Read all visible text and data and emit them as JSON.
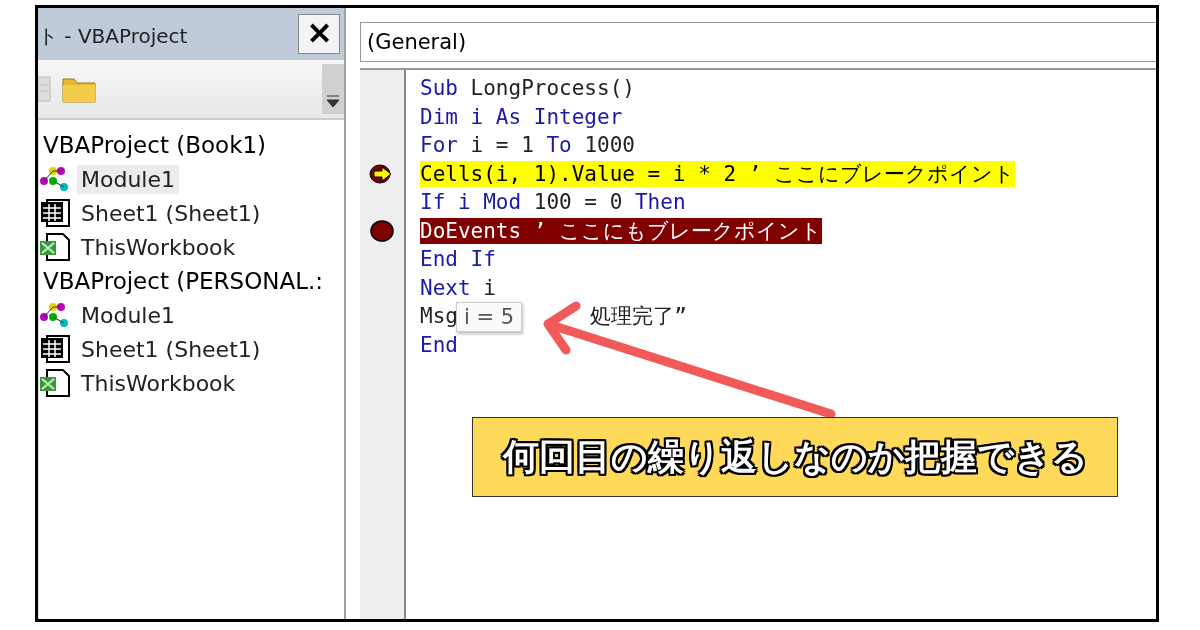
{
  "project_panel": {
    "title": "ト - VBAProject",
    "close": "✕",
    "tree": [
      {
        "label": "VBAProject (Book1)",
        "children": [
          {
            "label": "Module1",
            "kind": "module",
            "selected": true
          },
          {
            "label": "Sheet1 (Sheet1)",
            "kind": "sheet",
            "selected": false
          },
          {
            "label": "ThisWorkbook",
            "kind": "workbook",
            "selected": false
          }
        ]
      },
      {
        "label": "VBAProject (PERSONAL.:",
        "children": [
          {
            "label": "Module1",
            "kind": "module",
            "selected": false
          },
          {
            "label": "Sheet1 (Sheet1)",
            "kind": "sheet",
            "selected": false
          },
          {
            "label": "ThisWorkbook",
            "kind": "workbook",
            "selected": false
          }
        ]
      }
    ]
  },
  "code_window": {
    "object_box": "(General)",
    "lines": [
      {
        "current": false,
        "breakpoint": false,
        "parts": [
          {
            "text": "Sub",
            "keyword": true
          },
          {
            "text": " LongProcess()",
            "keyword": false
          }
        ]
      },
      {
        "current": false,
        "breakpoint": false,
        "parts": [
          {
            "text": "Dim i As Integer",
            "keyword": true
          }
        ]
      },
      {
        "current": false,
        "breakpoint": false,
        "parts": [
          {
            "text": "For",
            "keyword": true
          },
          {
            "text": " i = 1 ",
            "keyword": false
          },
          {
            "text": "To",
            "keyword": true
          },
          {
            "text": " 1000",
            "keyword": false
          }
        ]
      },
      {
        "current": true,
        "breakpoint": true,
        "parts": [
          {
            "text": "Cells(i, 1).Value = i * 2 ’ ここにブレークポイント"
          }
        ]
      },
      {
        "current": false,
        "breakpoint": false,
        "parts": [
          {
            "text": "If i Mod",
            "keyword": true
          },
          {
            "text": " 100 = 0 ",
            "keyword": false
          },
          {
            "text": "Then",
            "keyword": true
          }
        ]
      },
      {
        "current": false,
        "breakpoint": true,
        "parts": [
          {
            "text": "DoEvents ’ ここにもブレークポイント"
          }
        ]
      },
      {
        "current": false,
        "breakpoint": false,
        "parts": [
          {
            "text": "End If",
            "keyword": true
          }
        ]
      },
      {
        "current": false,
        "breakpoint": false,
        "parts": [
          {
            "text": "Next",
            "keyword": true
          },
          {
            "text": " i",
            "keyword": false
          }
        ]
      },
      {
        "current": false,
        "breakpoint": false,
        "parts": [
          {
            "text": "Msg",
            "keyword": false
          },
          {
            "kind": "gap"
          },
          {
            "text": "処理完了”",
            "keyword": false
          }
        ]
      },
      {
        "current": false,
        "breakpoint": false,
        "parts": [
          {
            "text": "End",
            "keyword": true
          }
        ]
      }
    ],
    "tooltip": "i = 5"
  },
  "callout": {
    "text": "何回目の繰り返しなのか把握できる"
  }
}
